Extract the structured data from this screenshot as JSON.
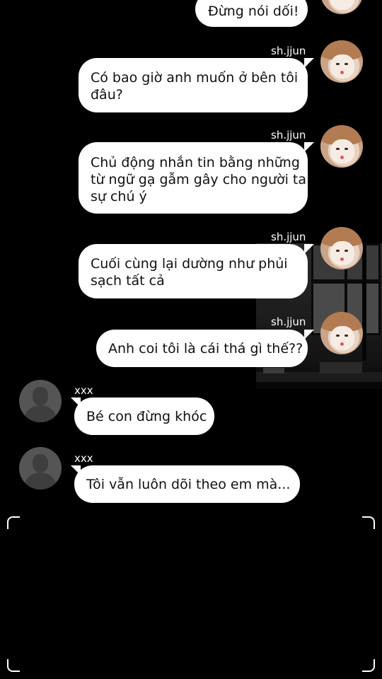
{
  "messages": [
    {
      "sender": "",
      "text": "Đừng nói dối!"
    },
    {
      "sender": "sh.jjun",
      "text": "Có bao giờ anh muốn ở bên tôi\nđâu?"
    },
    {
      "sender": "sh.jjun",
      "text": "Chủ động nhắn tin bằng những\ntừ ngữ gạ gẫm gây cho người ta\nsự chú ý"
    },
    {
      "sender": "sh.jjun",
      "text": "Cuối cùng lại dường như phủi\nsạch tất cả"
    },
    {
      "sender": "sh.jjun",
      "text": "Anh coi tôi là cái thá gì thế??"
    },
    {
      "sender": "xxx",
      "text": "Bé con đừng khóc"
    },
    {
      "sender": "xxx",
      "text": "Tôi vẫn luôn dõi theo em mà..."
    }
  ],
  "colors": {
    "background": "#000000",
    "bubble": "#ffffff",
    "text": "#111111",
    "name": "#ffffff"
  },
  "icons": {
    "sh_avatar": "user-photo-avatar",
    "xxx_avatar": "default-user-silhouette-icon"
  }
}
